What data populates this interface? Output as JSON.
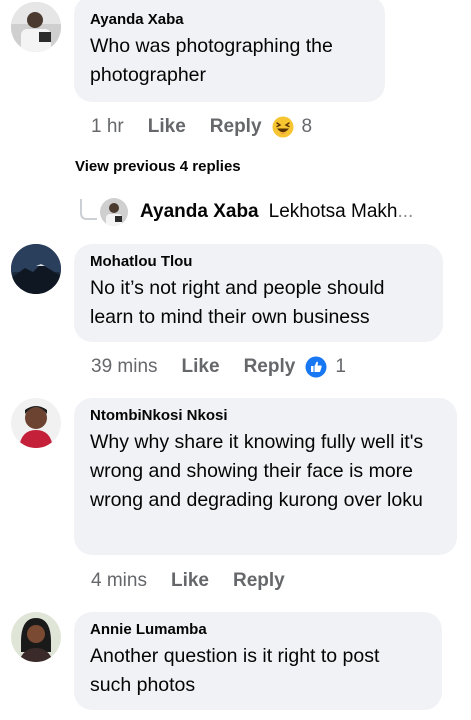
{
  "comments": [
    {
      "author": "Ayanda Xaba",
      "text": "Who was photographing the photographer",
      "time": "1 hr",
      "like_label": "Like",
      "reply_label": "Reply",
      "reaction_icon": "laugh-emoji-icon",
      "reaction_count": "8"
    },
    {
      "author": "Mohatlou Tlou",
      "text": "No it’s not right and people should learn to mind their own business",
      "time": "39 mins",
      "like_label": "Like",
      "reply_label": "Reply",
      "reaction_icon": "like-thumb-icon",
      "reaction_count": "1"
    },
    {
      "author": "NtombiNkosi Nkosi",
      "text": "Why why share it knowing fully well it's wrong and showing their face is more wrong and degrading kurong over loku",
      "time": "4 mins",
      "like_label": "Like",
      "reply_label": "Reply"
    },
    {
      "author": "Annie Lumamba",
      "text": "Another question is it right to post such photos"
    }
  ],
  "view_previous": "View previous 4 replies",
  "collapsed_reply": {
    "author": "Ayanda Xaba",
    "preview": "Lekhotsa Makh",
    "ellipsis": "..."
  },
  "colors": {
    "bubble": "#f0f2f5",
    "meta_text": "#65676b",
    "like_blue": "#1877f2",
    "emoji_yellow": "#f7c531"
  }
}
